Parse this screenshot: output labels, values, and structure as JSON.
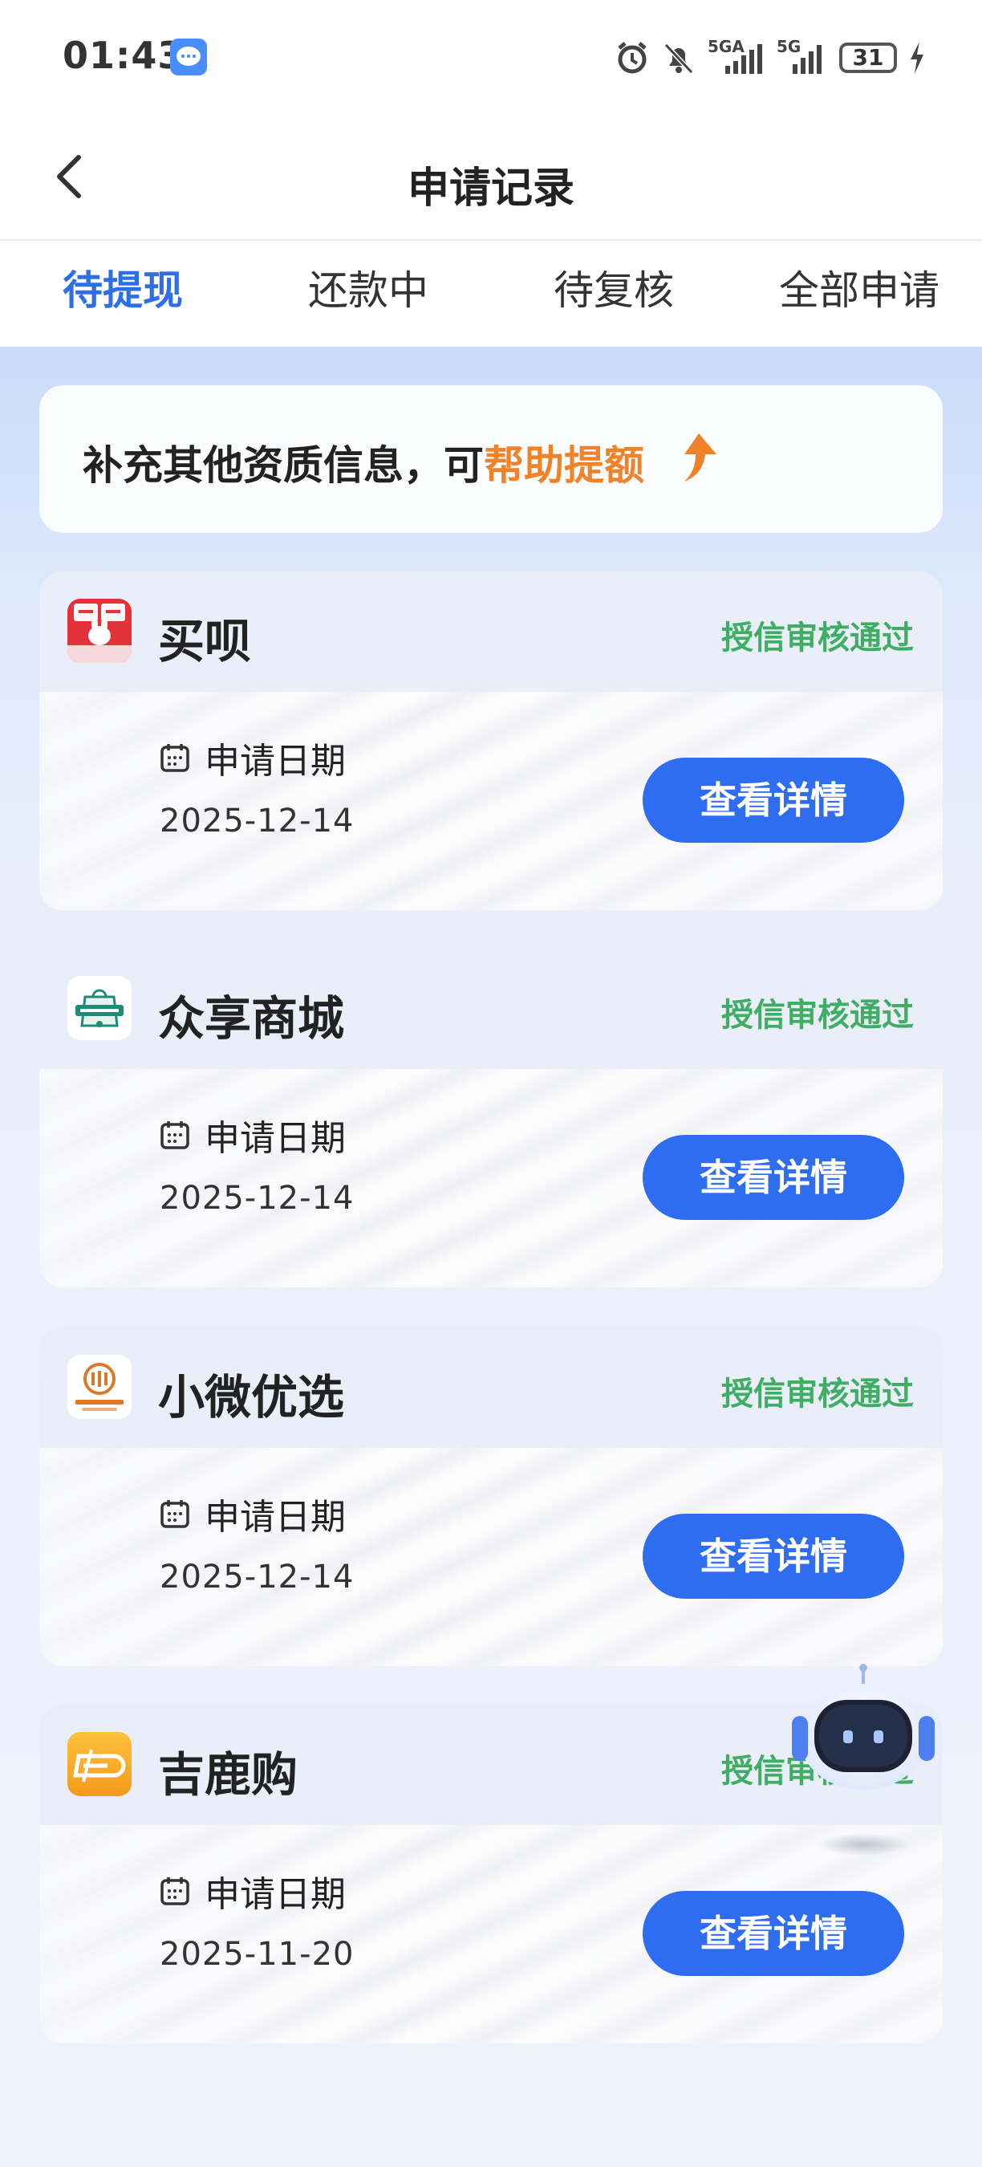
{
  "status_bar": {
    "time": "01:43",
    "network_1": "5GA",
    "network_2": "5G",
    "battery": "31"
  },
  "nav": {
    "title": "申请记录"
  },
  "tabs": [
    {
      "label": "待提现",
      "active": true
    },
    {
      "label": "还款中",
      "active": false
    },
    {
      "label": "待复核",
      "active": false
    },
    {
      "label": "全部申请",
      "active": false
    }
  ],
  "promo": {
    "text": "补充其他资质信息，可",
    "highlight": "帮助提额",
    "highlight_color": "#f0832a"
  },
  "records": [
    {
      "app_name": "买呗",
      "status": "授信审核通过",
      "date_label": "申请日期",
      "date": "2025-12-14",
      "button": "查看详情",
      "logo": "maibei-logo"
    },
    {
      "app_name": "众享商城",
      "status": "授信审核通过",
      "date_label": "申请日期",
      "date": "2025-12-14",
      "button": "查看详情",
      "logo": "zhongxiang-logo"
    },
    {
      "app_name": "小微优选",
      "status": "授信审核通过",
      "date_label": "申请日期",
      "date": "2025-12-14",
      "button": "查看详情",
      "logo": "xiaowei-logo"
    },
    {
      "app_name": "吉鹿购",
      "status": "授信审核通过",
      "date_label": "申请日期",
      "date": "2025-11-20",
      "button": "查看详情",
      "logo": "jilugou-logo"
    }
  ],
  "colors": {
    "accent": "#2f6df0",
    "status_green": "#3fae63",
    "tab_active": "#2f6fe6"
  }
}
